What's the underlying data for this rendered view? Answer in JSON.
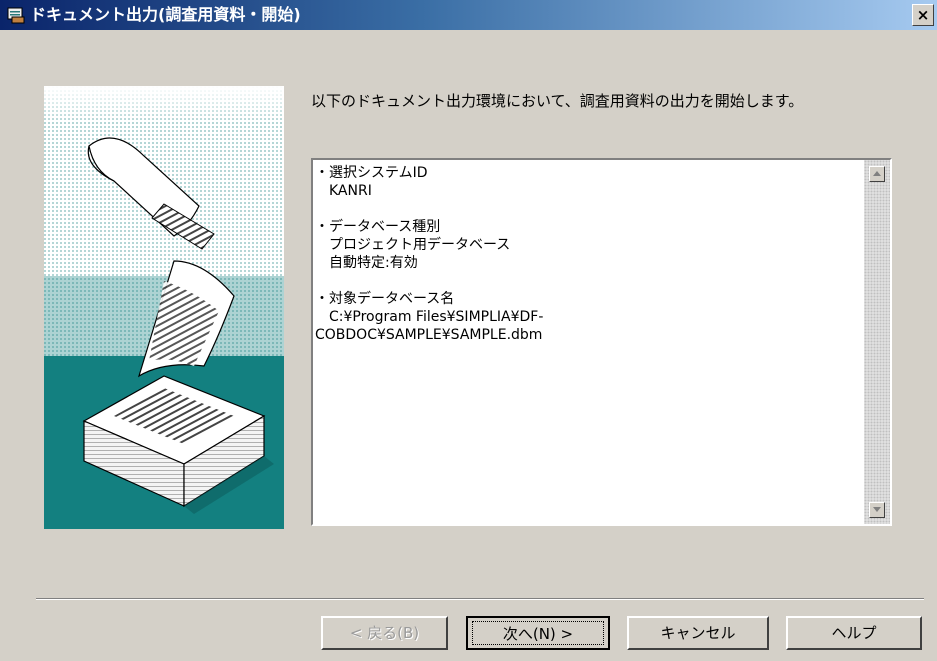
{
  "window": {
    "title": "ドキュメント出力(調査用資料・開始)",
    "close_label": "×"
  },
  "intro_text": "以下のドキュメント出力環境において、調査用資料の出力を開始します。",
  "info": {
    "system_id_heading": "・選択システムID",
    "system_id_value": "KANRI",
    "db_type_heading": "・データベース種別",
    "db_type_value": "プロジェクト用データベース",
    "auto_detect_value": "自動特定:有効",
    "db_name_heading": "・対象データベース名",
    "db_name_value_line1": "C:¥Program Files¥SIMPLIA¥DF-",
    "db_name_value_line2": "COBDOC¥SAMPLE¥SAMPLE.dbm"
  },
  "buttons": {
    "back": "< 戻る(B)",
    "next": "次へ(N) >",
    "cancel": "キャンセル",
    "help": "ヘルプ"
  },
  "colors": {
    "dialog_bg": "#d4d0c8",
    "title_start": "#0a246a",
    "title_end": "#a6caf0",
    "illustration_teal": "#138080"
  },
  "icons": {
    "window_icon": "printer-document-icon",
    "scroll_up": "scroll-up-arrow-icon",
    "scroll_down": "scroll-down-arrow-icon"
  }
}
